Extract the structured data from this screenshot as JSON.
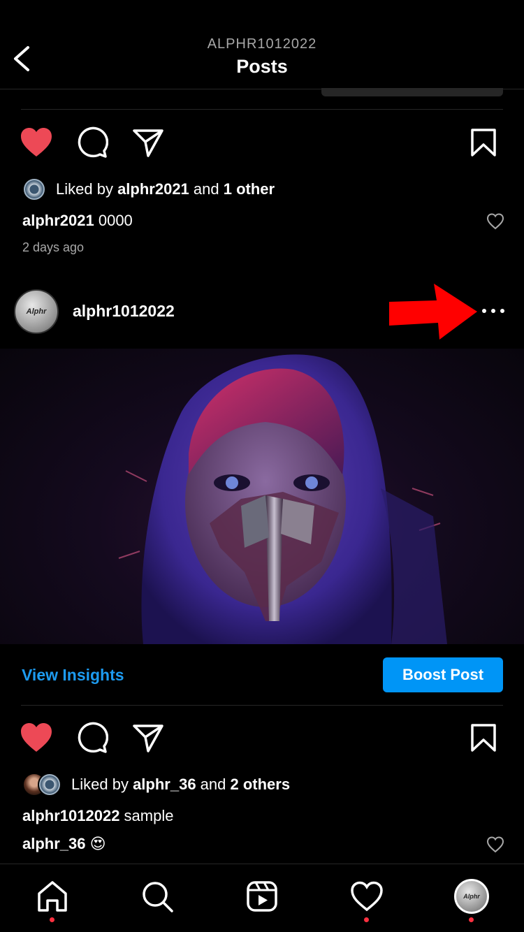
{
  "header": {
    "subtitle": "ALPHR1012022",
    "title": "Posts"
  },
  "prev_post": {
    "liked_prefix": "Liked by ",
    "liked_user": "alphr2021",
    "liked_mid": " and ",
    "liked_count": "1 other",
    "caption_user": "alphr2021",
    "caption_text": " 0000",
    "time_ago": "2 days ago"
  },
  "post": {
    "username": "alphr1012022",
    "avatar_text": "Alphr",
    "view_insights": "View Insights",
    "boost_post": "Boost Post",
    "liked_prefix": "Liked by ",
    "liked_user": "alphr_36",
    "liked_mid": " and ",
    "liked_count": "2 others",
    "caption_user": "alphr1012022",
    "caption_text": " sample",
    "comment_user": "alphr_36",
    "comment_text": " 😍"
  },
  "colors": {
    "accent": "#0095f6",
    "like": "#ed4956",
    "notification_dot": "#ff3040",
    "annotation_arrow": "#ff0000"
  },
  "icons": {
    "back": "chevron-left-icon",
    "like": "heart-filled-icon",
    "comment": "comment-icon",
    "share": "paper-plane-icon",
    "save": "bookmark-icon",
    "more": "more-horizontal-icon",
    "home": "home-icon",
    "search": "search-icon",
    "reels": "reels-icon",
    "activity": "heart-outline-icon"
  },
  "nav": {
    "profile_avatar_text": "Alphr"
  }
}
